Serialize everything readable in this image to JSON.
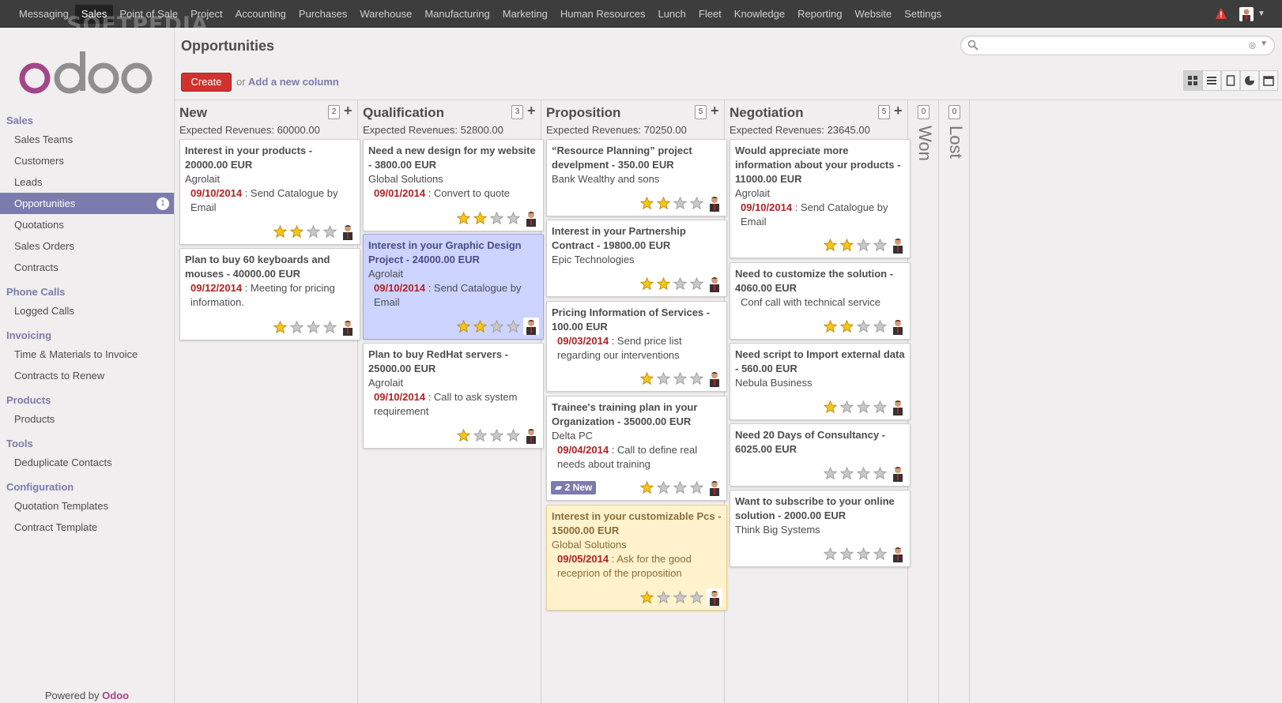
{
  "topbar": {
    "watermark": "SOFTPEDIA",
    "menu": [
      {
        "label": "Messaging"
      },
      {
        "label": "Sales",
        "active": true
      },
      {
        "label": "Point of Sale"
      },
      {
        "label": "Project"
      },
      {
        "label": "Accounting"
      },
      {
        "label": "Purchases"
      },
      {
        "label": "Warehouse"
      },
      {
        "label": "Manufacturing"
      },
      {
        "label": "Marketing"
      },
      {
        "label": "Human Resources"
      },
      {
        "label": "Lunch"
      },
      {
        "label": "Fleet"
      },
      {
        "label": "Knowledge"
      },
      {
        "label": "Reporting"
      },
      {
        "label": "Website"
      },
      {
        "label": "Settings"
      }
    ]
  },
  "sidebar": {
    "logo_text": "odoo",
    "sections": [
      {
        "title": "Sales",
        "items": [
          {
            "label": "Sales Teams"
          },
          {
            "label": "Customers"
          },
          {
            "label": "Leads"
          },
          {
            "label": "Opportunities",
            "active": true,
            "badge": "1"
          },
          {
            "label": "Quotations"
          },
          {
            "label": "Sales Orders"
          },
          {
            "label": "Contracts"
          }
        ]
      },
      {
        "title": "Phone Calls",
        "items": [
          {
            "label": "Logged Calls"
          }
        ]
      },
      {
        "title": "Invoicing",
        "items": [
          {
            "label": "Time & Materials to Invoice"
          },
          {
            "label": "Contracts to Renew"
          }
        ]
      },
      {
        "title": "Products",
        "items": [
          {
            "label": "Products"
          }
        ]
      },
      {
        "title": "Tools",
        "items": [
          {
            "label": "Deduplicate Contacts"
          }
        ]
      },
      {
        "title": "Configuration",
        "items": [
          {
            "label": "Quotation Templates"
          },
          {
            "label": "Contract Template"
          }
        ]
      }
    ],
    "powered_prefix": "Powered by ",
    "powered_brand": "Odoo"
  },
  "header": {
    "title": "Opportunities",
    "search_placeholder": "",
    "create_label": "Create",
    "or_label": "or",
    "add_column_label": "Add a new column"
  },
  "colors": {
    "accent": "#7c7bad",
    "create": "#d2322d",
    "date": "#b22222",
    "star_on": "#f5c518",
    "star_off": "#c8c8c8"
  },
  "columns": [
    {
      "name": "New",
      "count": "2",
      "revenue": "Expected Revenues: 60000.00",
      "cards": [
        {
          "title": "Interest in your products - 20000.00 EUR",
          "partner": "Agrolait",
          "date": "09/10/2014",
          "activity": "Send Catalogue by Email",
          "stars": 2,
          "color": "white"
        },
        {
          "title": "Plan to buy 60 keyboards and mouses - 40000.00 EUR",
          "partner": "",
          "date": "09/12/2014",
          "activity": "Meeting for pricing information.",
          "stars": 1,
          "color": "white"
        }
      ]
    },
    {
      "name": "Qualification",
      "count": "3",
      "revenue": "Expected Revenues: 52800.00",
      "cards": [
        {
          "title": "Need a new design for my website - 3800.00 EUR",
          "partner": "Global Solutions",
          "date": "09/01/2014",
          "activity": "Convert to quote",
          "stars": 2,
          "color": "white"
        },
        {
          "title": "Interest in your Graphic Design Project - 24000.00 EUR",
          "partner": "Agrolait",
          "date": "09/10/2014",
          "activity": "Send Catalogue by Email",
          "stars": 2,
          "color": "blue"
        },
        {
          "title": "Plan to buy RedHat servers - 25000.00 EUR",
          "partner": "Agrolait",
          "date": "09/10/2014",
          "activity": "Call to ask system requirement",
          "stars": 1,
          "color": "white"
        }
      ]
    },
    {
      "name": "Proposition",
      "count": "5",
      "revenue": "Expected Revenues: 70250.00",
      "cards": [
        {
          "title": "“Resource Planning” project develpment - 350.00 EUR",
          "partner": "Bank Wealthy and sons",
          "date": "",
          "activity": "",
          "stars": 2,
          "color": "white"
        },
        {
          "title": "Interest in your Partnership Contract - 19800.00 EUR",
          "partner": "Epic Technologies",
          "date": "",
          "activity": "",
          "stars": 2,
          "color": "white"
        },
        {
          "title": "Pricing Information of Services - 100.00 EUR",
          "partner": "",
          "date": "09/03/2014",
          "activity": "Send price list regarding our interventions",
          "stars": 1,
          "color": "white"
        },
        {
          "title": "Trainee's training plan in your Organization - 35000.00 EUR",
          "partner": "Delta PC",
          "date": "09/04/2014",
          "activity": "Call to define real needs about training",
          "stars": 1,
          "color": "white",
          "badge": "2 New"
        },
        {
          "title": "Interest in your customizable Pcs - 15000.00 EUR",
          "partner": "Global Solutions",
          "date": "09/05/2014",
          "activity": "Ask for the good receprion of the proposition",
          "stars": 1,
          "color": "yellow"
        }
      ]
    },
    {
      "name": "Negotiation",
      "count": "5",
      "revenue": "Expected Revenues: 23645.00",
      "cards": [
        {
          "title": "Would appreciate more information about your products - 11000.00 EUR",
          "partner": "Agrolait",
          "date": "09/10/2014",
          "activity": "Send Catalogue by Email",
          "stars": 2,
          "color": "white"
        },
        {
          "title": "Need to customize the solution - 4060.00 EUR",
          "partner": "",
          "date": "",
          "activity": "Conf call with technical service",
          "stars": 2,
          "color": "white"
        },
        {
          "title": "Need script to Import external data - 560.00 EUR",
          "partner": "Nebula Business",
          "date": "",
          "activity": "",
          "stars": 1,
          "color": "white"
        },
        {
          "title": "Need 20 Days of Consultancy - 6025.00 EUR",
          "partner": "",
          "date": "",
          "activity": "",
          "stars": 0,
          "color": "white"
        },
        {
          "title": "Want to subscribe to your online solution - 2000.00 EUR",
          "partner": "Think Big Systems",
          "date": "",
          "activity": "",
          "stars": 0,
          "color": "white"
        }
      ]
    }
  ],
  "folded_columns": [
    {
      "name": "Won",
      "count": "0"
    },
    {
      "name": "Lost",
      "count": "0"
    }
  ]
}
